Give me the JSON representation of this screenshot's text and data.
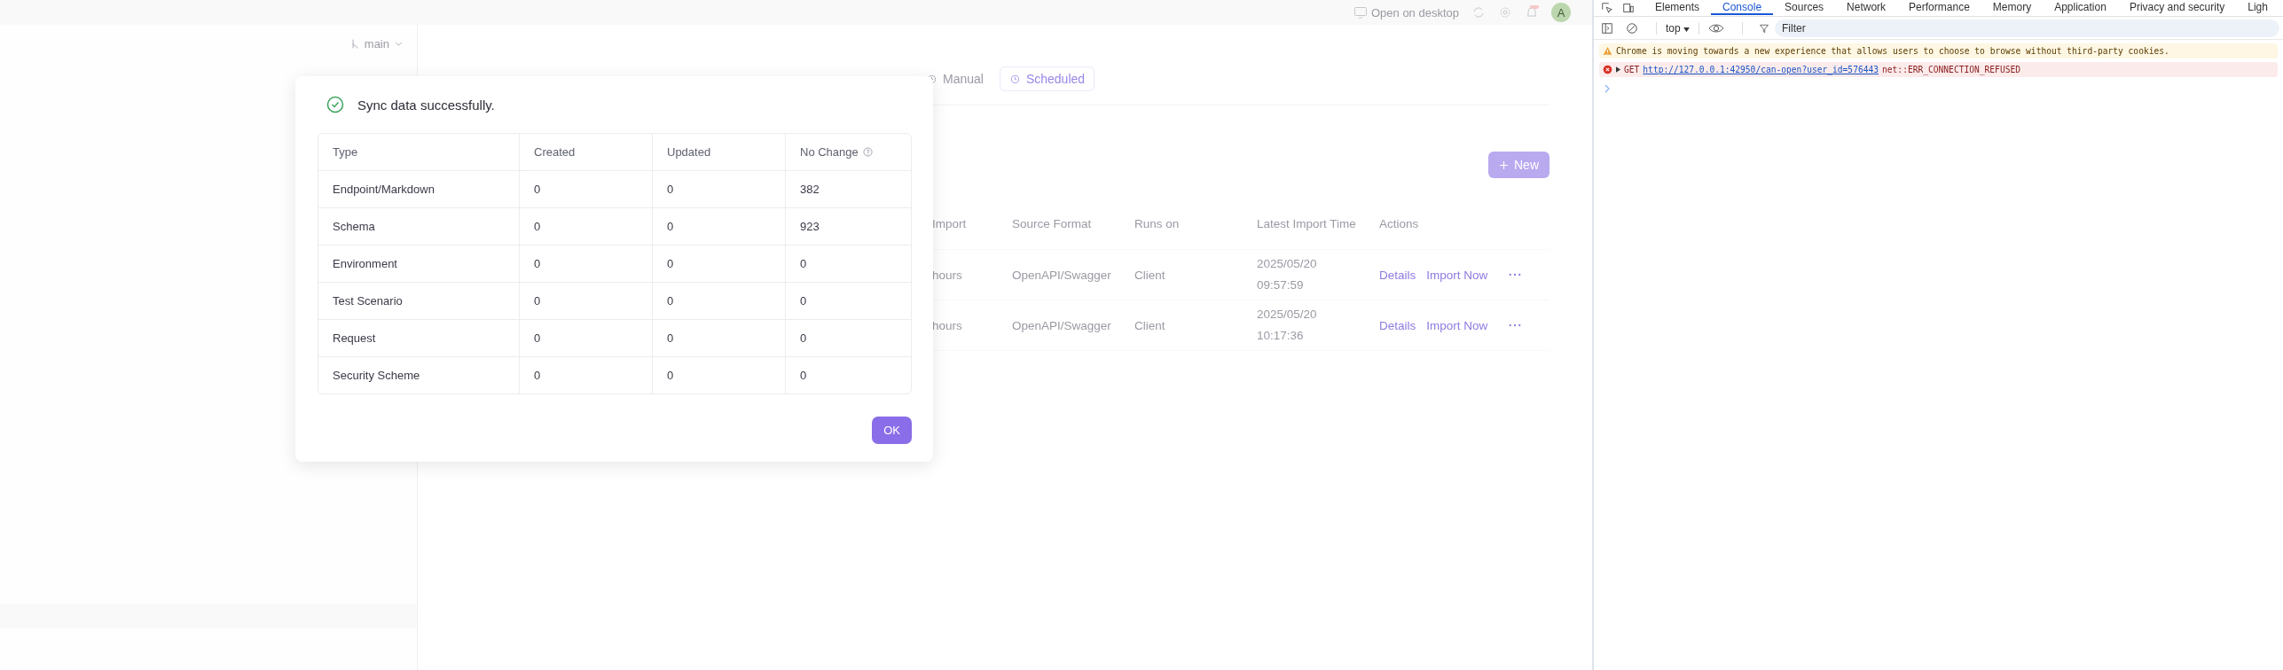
{
  "top_bar": {
    "open_desktop": "Open on desktop",
    "avatar": "A"
  },
  "sidebar": {
    "branch": "main"
  },
  "page": {
    "tabs": [
      {
        "label": "Manual",
        "selected": false
      },
      {
        "label": "Scheduled",
        "selected": true
      }
    ],
    "new_button": "New",
    "table": {
      "columns": [
        "Import",
        "Source Format",
        "Runs on",
        "Latest Import Time",
        "Actions"
      ],
      "rows": [
        {
          "column_1": "hours",
          "source_format": "OpenAPI/Swagger",
          "runs_on": "Client",
          "time": [
            "2025/05/20",
            "09:57:59"
          ],
          "actions": [
            "Details",
            "Import Now"
          ]
        },
        {
          "column_1": "hours",
          "source_format": "OpenAPI/Swagger",
          "runs_on": "Client",
          "time": [
            "2025/05/20",
            "10:17:36"
          ],
          "actions": [
            "Details",
            "Import Now"
          ]
        }
      ]
    }
  },
  "dialog": {
    "title": "Sync data successfully.",
    "columns": [
      "Type",
      "Created",
      "Updated",
      "No Change"
    ],
    "rows": [
      [
        "Endpoint/Markdown",
        "0",
        "0",
        "382"
      ],
      [
        "Schema",
        "0",
        "0",
        "923"
      ],
      [
        "Environment",
        "0",
        "0",
        "0"
      ],
      [
        "Test Scenario",
        "0",
        "0",
        "0"
      ],
      [
        "Request",
        "0",
        "0",
        "0"
      ],
      [
        "Security Scheme",
        "0",
        "0",
        "0"
      ]
    ],
    "ok": "OK"
  },
  "devtools": {
    "tabs": [
      {
        "label": "Elements",
        "selected": false
      },
      {
        "label": "Console",
        "selected": true
      },
      {
        "label": "Sources",
        "selected": false
      },
      {
        "label": "Network",
        "selected": false
      },
      {
        "label": "Performance",
        "selected": false
      },
      {
        "label": "Memory",
        "selected": false
      },
      {
        "label": "Application",
        "selected": false
      },
      {
        "label": "Privacy and security",
        "selected": false
      },
      {
        "label": "Ligh",
        "selected": false
      }
    ],
    "context": "top",
    "filter_placeholder": "Filter",
    "messages": [
      {
        "kind": "warning",
        "text": "Chrome is moving towards a new experience that allows users to choose to browse without third-party cookies."
      },
      {
        "kind": "error",
        "method": "GET",
        "url": "http://127.0.0.1:42950/can-open?user_id=576443",
        "text": "net::ERR_CONNECTION_REFUSED"
      }
    ]
  }
}
